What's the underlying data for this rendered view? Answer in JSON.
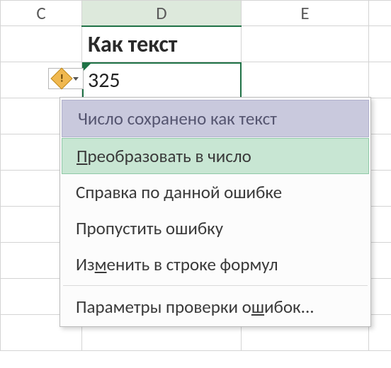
{
  "columns": {
    "c": "C",
    "d": "D",
    "e": "E"
  },
  "cells": {
    "d2": "Как текст",
    "d3": "325"
  },
  "smart_tag": {
    "bang": "!"
  },
  "menu": {
    "title": "Число сохранено как текст",
    "convert_pre": "",
    "convert_mn": "П",
    "convert_post": "реобразовать в число",
    "help": "Справка по данной ошибке",
    "skip": "Пропустить ошибку",
    "edit_pre": "Из",
    "edit_mn": "м",
    "edit_post": "енить в строке формул",
    "params_pre": "Параметры проверки о",
    "params_mn": "ш",
    "params_post": "ибок..."
  }
}
